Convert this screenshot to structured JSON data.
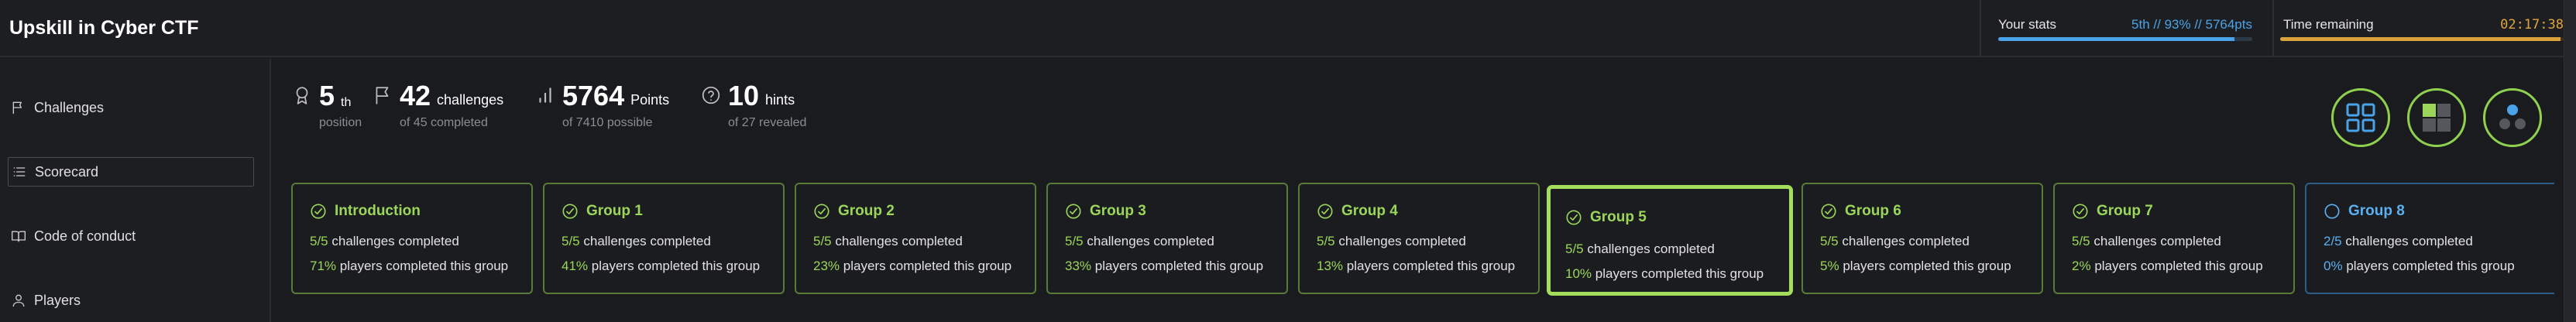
{
  "app": {
    "title": "Upskill in Cyber CTF"
  },
  "header": {
    "stats_label": "Your stats",
    "stats_value": "5th // 93% // 5764pts",
    "stats_progress": 0.93,
    "time_label": "Time remaining",
    "time_value": "02:17:38",
    "time_progress": 0.99
  },
  "sidebar": {
    "items": [
      {
        "label": "Challenges",
        "icon": "flag-icon",
        "active": false
      },
      {
        "label": "Scorecard",
        "icon": "list-icon",
        "active": true
      },
      {
        "label": "Code of conduct",
        "icon": "book-icon",
        "active": false
      },
      {
        "label": "Players",
        "icon": "user-icon",
        "active": false
      }
    ]
  },
  "stats": {
    "position": {
      "value": "5",
      "suffix": "th",
      "sub": "position",
      "icon": "award-icon"
    },
    "challenges": {
      "value": "42",
      "unit": "challenges",
      "sub": "of 45 completed",
      "icon": "flag-icon"
    },
    "points": {
      "value": "5764",
      "unit": "Points",
      "sub": "of 7410 possible",
      "icon": "bar-chart-icon"
    },
    "hints": {
      "value": "10",
      "unit": "hints",
      "sub": "of 27 revealed",
      "icon": "help-circle-icon"
    }
  },
  "view_buttons": [
    {
      "name": "grid-view-icon"
    },
    {
      "name": "blocks-view-icon"
    },
    {
      "name": "dots-view-icon"
    }
  ],
  "groups": [
    {
      "title": "Introduction",
      "completed": "5/5",
      "completed_text": "challenges completed",
      "players_pct": "71%",
      "players_text": "players completed this group",
      "status": "complete"
    },
    {
      "title": "Group 1",
      "completed": "5/5",
      "completed_text": "challenges completed",
      "players_pct": "41%",
      "players_text": "players completed this group",
      "status": "complete"
    },
    {
      "title": "Group 2",
      "completed": "5/5",
      "completed_text": "challenges completed",
      "players_pct": "23%",
      "players_text": "players completed this group",
      "status": "complete"
    },
    {
      "title": "Group 3",
      "completed": "5/5",
      "completed_text": "challenges completed",
      "players_pct": "33%",
      "players_text": "players completed this group",
      "status": "complete"
    },
    {
      "title": "Group 4",
      "completed": "5/5",
      "completed_text": "challenges completed",
      "players_pct": "13%",
      "players_text": "players completed this group",
      "status": "complete"
    },
    {
      "title": "Group 5",
      "completed": "5/5",
      "completed_text": "challenges completed",
      "players_pct": "10%",
      "players_text": "players completed this group",
      "status": "selected"
    },
    {
      "title": "Group 6",
      "completed": "5/5",
      "completed_text": "challenges completed",
      "players_pct": "5%",
      "players_text": "players completed this group",
      "status": "complete"
    },
    {
      "title": "Group 7",
      "completed": "5/5",
      "completed_text": "challenges completed",
      "players_pct": "2%",
      "players_text": "players completed this group",
      "status": "complete"
    },
    {
      "title": "Group 8",
      "completed": "2/5",
      "completed_text": "challenges completed",
      "players_pct": "0%",
      "players_text": "players completed this group",
      "status": "incomplete"
    }
  ],
  "colors": {
    "accent_green": "#9bd65a",
    "accent_blue": "#4aa3e8",
    "accent_amber": "#e0a53a",
    "background": "#1a1b1e"
  }
}
